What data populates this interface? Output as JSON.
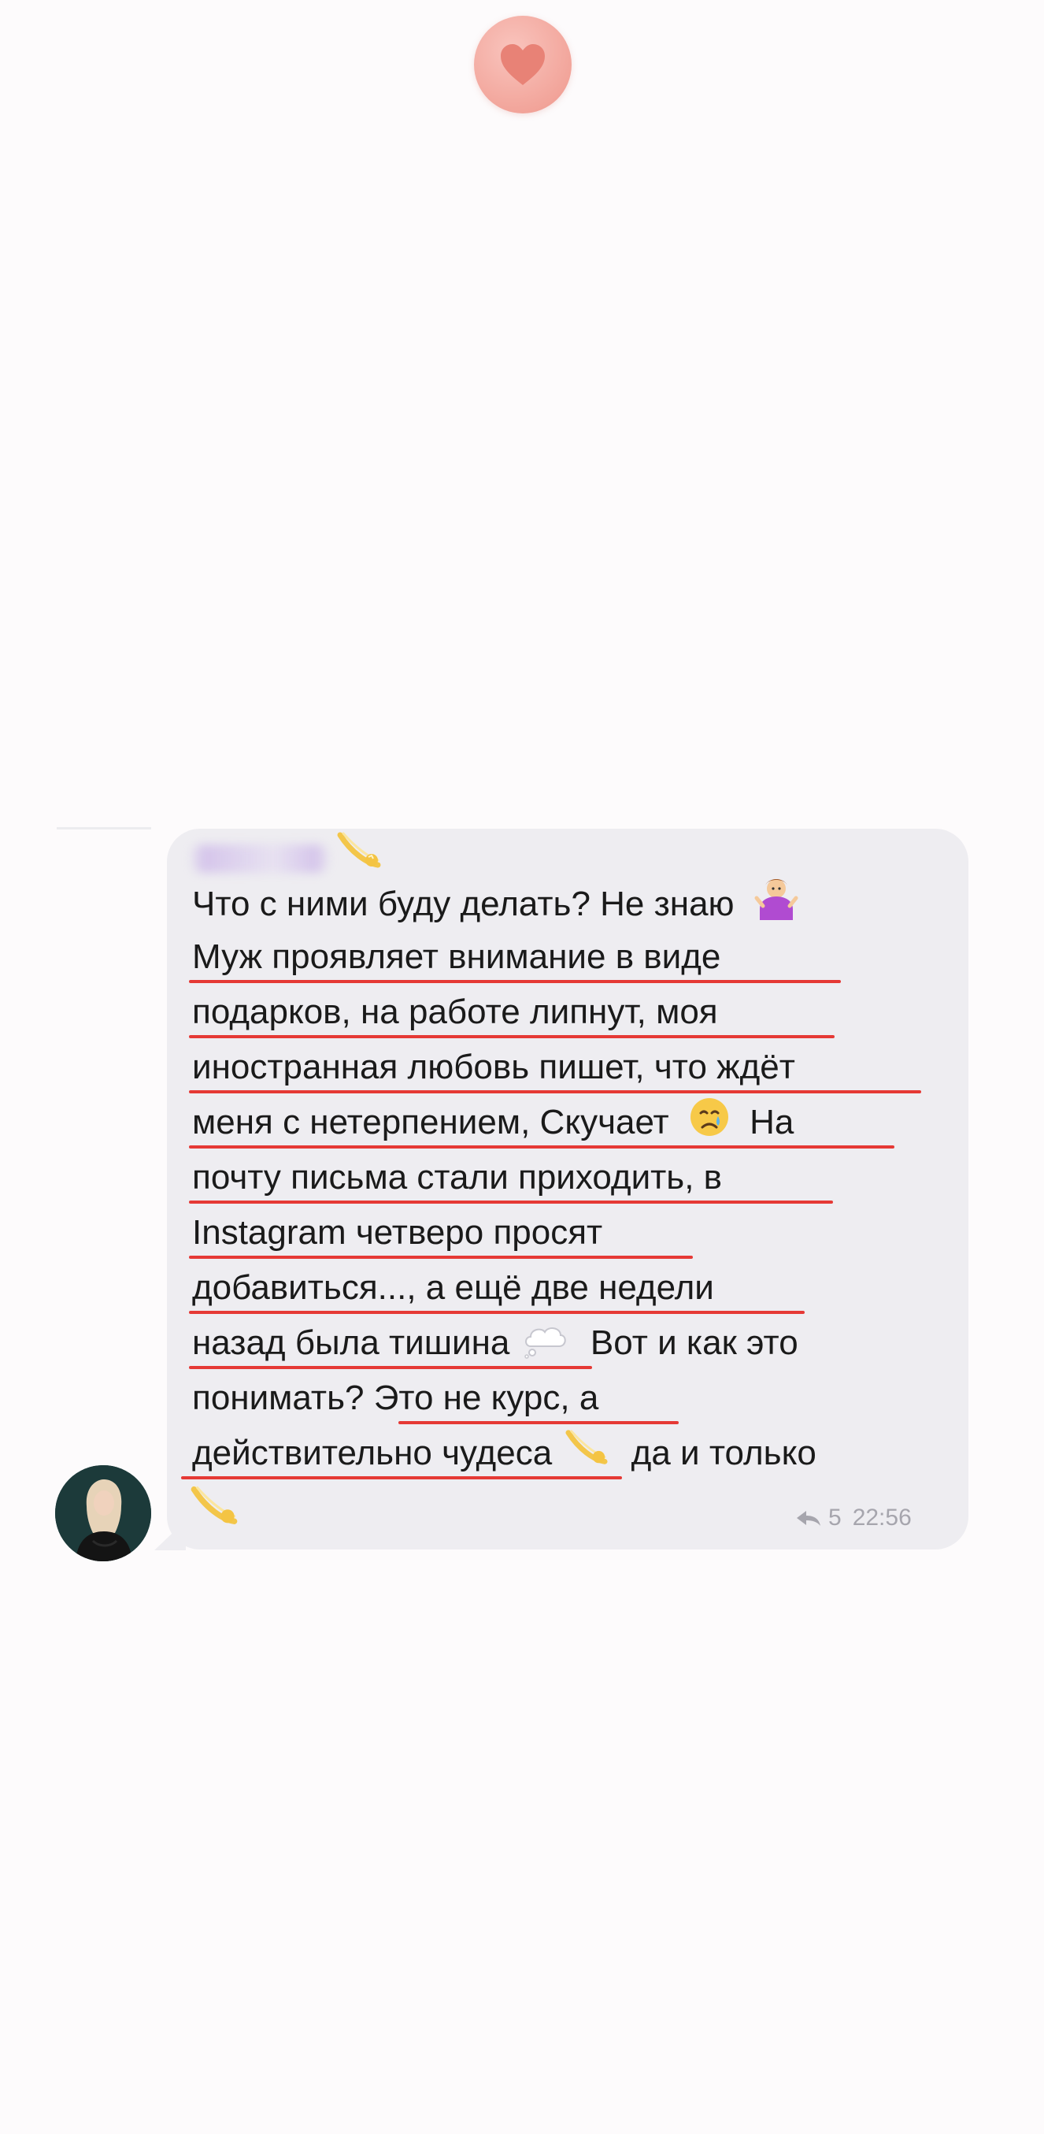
{
  "header": {
    "badge_icon": "heart-icon",
    "badge_color": "#f2a59b",
    "heart_color": "#e88276"
  },
  "message": {
    "sender_icon": "dizzy-comet-icon",
    "lines": [
      {
        "text": "Что с ними буду делать? Не знаю",
        "emoji": "woman-shrugging-icon"
      },
      {
        "text": "Муж проявляет внимание в виде"
      },
      {
        "text": "подарков, на работе липнут, моя"
      },
      {
        "text": "иностранная любовь пишет, что ждёт"
      },
      {
        "text": "меня с нетерпением, Скучает",
        "emoji": "crying-face-icon",
        "after": "На"
      },
      {
        "text": "почту письма стали приходить, в"
      },
      {
        "text": "Instagram четверо просят"
      },
      {
        "text": "добавиться..., а ещё две недели"
      },
      {
        "text": "назад  была тишина",
        "emoji": "thought-bubble-icon",
        "after": "Вот и как это"
      },
      {
        "text": "понимать? Это не курс, а"
      },
      {
        "text": "действительно чудеса",
        "emoji": "dizzy-comet-icon",
        "after": "да и только"
      }
    ],
    "trailing_emoji": "dizzy-comet-icon",
    "reply_count": "5",
    "time": "22:56",
    "reply_icon": "reply-arrow-icon",
    "underline_color": "#e53935",
    "bubble_color": "#eeedf1"
  },
  "avatar": {
    "icon": "user-avatar"
  }
}
